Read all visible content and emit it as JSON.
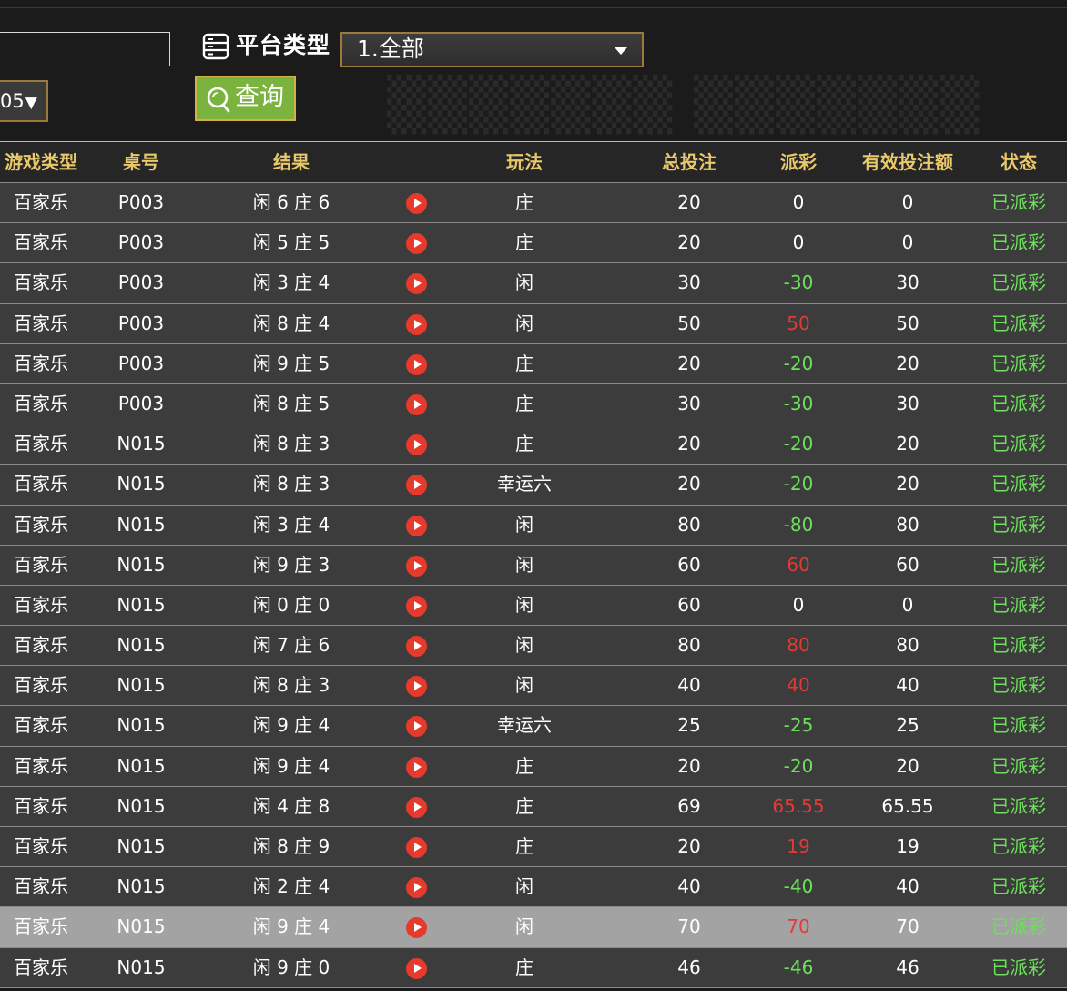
{
  "filters": {
    "platform_label": "平台类型",
    "platform_selected": "1.全部",
    "date_fragment": "05",
    "query_label": "查询"
  },
  "table": {
    "headers": [
      "游戏类型",
      "桌号",
      "结果",
      "玩法",
      "总投注",
      "派彩",
      "有效投注额",
      "状态"
    ],
    "colors": {
      "header": "#e8c86a",
      "positive": "#e53935",
      "negative": "#6ce05a",
      "neutral": "#ffffff",
      "status": "#6ce05a"
    },
    "rows": [
      {
        "game": "百家乐",
        "table": "P003",
        "result": "闲 6 庄 6",
        "mode": "庄",
        "total": "20",
        "payout": "0",
        "payout_sign": "zero",
        "valid": "0",
        "status": "已派彩"
      },
      {
        "game": "百家乐",
        "table": "P003",
        "result": "闲 5 庄 5",
        "mode": "庄",
        "total": "20",
        "payout": "0",
        "payout_sign": "zero",
        "valid": "0",
        "status": "已派彩"
      },
      {
        "game": "百家乐",
        "table": "P003",
        "result": "闲 3 庄 4",
        "mode": "闲",
        "total": "30",
        "payout": "-30",
        "payout_sign": "neg",
        "valid": "30",
        "status": "已派彩"
      },
      {
        "game": "百家乐",
        "table": "P003",
        "result": "闲 8 庄 4",
        "mode": "闲",
        "total": "50",
        "payout": "50",
        "payout_sign": "pos",
        "valid": "50",
        "status": "已派彩"
      },
      {
        "game": "百家乐",
        "table": "P003",
        "result": "闲 9 庄 5",
        "mode": "庄",
        "total": "20",
        "payout": "-20",
        "payout_sign": "neg",
        "valid": "20",
        "status": "已派彩"
      },
      {
        "game": "百家乐",
        "table": "P003",
        "result": "闲 8 庄 5",
        "mode": "庄",
        "total": "30",
        "payout": "-30",
        "payout_sign": "neg",
        "valid": "30",
        "status": "已派彩"
      },
      {
        "game": "百家乐",
        "table": "N015",
        "result": "闲 8 庄 3",
        "mode": "庄",
        "total": "20",
        "payout": "-20",
        "payout_sign": "neg",
        "valid": "20",
        "status": "已派彩"
      },
      {
        "game": "百家乐",
        "table": "N015",
        "result": "闲 8 庄 3",
        "mode": "幸运六",
        "total": "20",
        "payout": "-20",
        "payout_sign": "neg",
        "valid": "20",
        "status": "已派彩"
      },
      {
        "game": "百家乐",
        "table": "N015",
        "result": "闲 3 庄 4",
        "mode": "闲",
        "total": "80",
        "payout": "-80",
        "payout_sign": "neg",
        "valid": "80",
        "status": "已派彩"
      },
      {
        "game": "百家乐",
        "table": "N015",
        "result": "闲 9 庄 3",
        "mode": "闲",
        "total": "60",
        "payout": "60",
        "payout_sign": "pos",
        "valid": "60",
        "status": "已派彩"
      },
      {
        "game": "百家乐",
        "table": "N015",
        "result": "闲 0 庄 0",
        "mode": "闲",
        "total": "60",
        "payout": "0",
        "payout_sign": "zero",
        "valid": "0",
        "status": "已派彩"
      },
      {
        "game": "百家乐",
        "table": "N015",
        "result": "闲 7 庄 6",
        "mode": "闲",
        "total": "80",
        "payout": "80",
        "payout_sign": "pos",
        "valid": "80",
        "status": "已派彩"
      },
      {
        "game": "百家乐",
        "table": "N015",
        "result": "闲 8 庄 3",
        "mode": "闲",
        "total": "40",
        "payout": "40",
        "payout_sign": "pos",
        "valid": "40",
        "status": "已派彩"
      },
      {
        "game": "百家乐",
        "table": "N015",
        "result": "闲 9 庄 4",
        "mode": "幸运六",
        "total": "25",
        "payout": "-25",
        "payout_sign": "neg",
        "valid": "25",
        "status": "已派彩"
      },
      {
        "game": "百家乐",
        "table": "N015",
        "result": "闲 9 庄 4",
        "mode": "庄",
        "total": "20",
        "payout": "-20",
        "payout_sign": "neg",
        "valid": "20",
        "status": "已派彩"
      },
      {
        "game": "百家乐",
        "table": "N015",
        "result": "闲 4 庄 8",
        "mode": "庄",
        "total": "69",
        "payout": "65.55",
        "payout_sign": "pos",
        "valid": "65.55",
        "status": "已派彩"
      },
      {
        "game": "百家乐",
        "table": "N015",
        "result": "闲 8 庄 9",
        "mode": "庄",
        "total": "20",
        "payout": "19",
        "payout_sign": "pos",
        "valid": "19",
        "status": "已派彩"
      },
      {
        "game": "百家乐",
        "table": "N015",
        "result": "闲 2 庄 4",
        "mode": "闲",
        "total": "40",
        "payout": "-40",
        "payout_sign": "neg",
        "valid": "40",
        "status": "已派彩"
      },
      {
        "game": "百家乐",
        "table": "N015",
        "result": "闲 9 庄 4",
        "mode": "闲",
        "total": "70",
        "payout": "70",
        "payout_sign": "pos",
        "valid": "70",
        "status": "已派彩",
        "highlighted": true
      },
      {
        "game": "百家乐",
        "table": "N015",
        "result": "闲 9 庄 0",
        "mode": "庄",
        "total": "46",
        "payout": "-46",
        "payout_sign": "neg",
        "valid": "46",
        "status": "已派彩"
      }
    ]
  }
}
